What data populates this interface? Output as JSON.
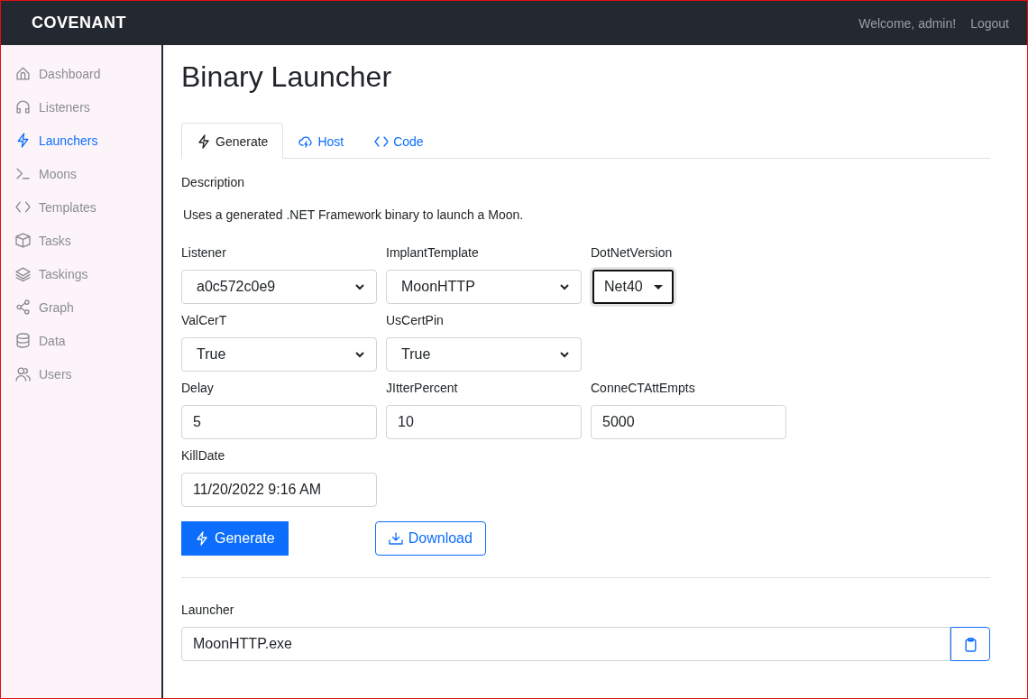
{
  "header": {
    "logo": "COVENANT",
    "welcome": "Welcome, admin!",
    "logout": "Logout"
  },
  "sidebar": {
    "items": [
      {
        "label": "Dashboard",
        "selected": false
      },
      {
        "label": "Listeners",
        "selected": false
      },
      {
        "label": "Launchers",
        "selected": true
      },
      {
        "label": "Moons",
        "selected": false
      },
      {
        "label": "Templates",
        "selected": false
      },
      {
        "label": "Tasks",
        "selected": false
      },
      {
        "label": "Taskings",
        "selected": false
      },
      {
        "label": "Graph",
        "selected": false
      },
      {
        "label": "Data",
        "selected": false
      },
      {
        "label": "Users",
        "selected": false
      }
    ]
  },
  "page": {
    "title": "Binary Launcher"
  },
  "tabs": [
    {
      "label": "Generate",
      "selected": true
    },
    {
      "label": "Host",
      "selected": false
    },
    {
      "label": "Code",
      "selected": false
    }
  ],
  "description": {
    "label": "Description",
    "text": "Uses a generated .NET Framework binary to launch a Moon."
  },
  "form_rows": [
    [
      {
        "label": "Listener",
        "kind": "select",
        "value": "a0c572c0e9",
        "focused": false
      },
      {
        "label": "ImplantTemplate",
        "kind": "select",
        "value": "MoonHTTP",
        "focused": false
      },
      {
        "label": "DotNetVersion",
        "kind": "select",
        "value": "Net40",
        "focused": true
      }
    ],
    [
      {
        "label": "ValCerT",
        "kind": "select",
        "value": "True",
        "focused": false
      },
      {
        "label": "UsCertPin",
        "kind": "select",
        "value": "True",
        "focused": false
      }
    ],
    [
      {
        "label": "Delay",
        "kind": "input",
        "value": "5",
        "focused": false
      },
      {
        "label": "JItterPercent",
        "kind": "input",
        "value": "10",
        "focused": false
      },
      {
        "label": "ConneCTAttEmpts",
        "kind": "input",
        "value": "5000",
        "focused": false
      }
    ],
    [
      {
        "label": "KillDate",
        "kind": "input",
        "value": "11/20/2022 9:16 AM",
        "focused": false
      }
    ]
  ],
  "buttons": [
    {
      "label": "Generate",
      "kind": "primary"
    },
    {
      "label": "Download",
      "kind": "outline"
    }
  ],
  "launcher": {
    "label": "Launcher",
    "value": "MoonHTTP.exe"
  }
}
